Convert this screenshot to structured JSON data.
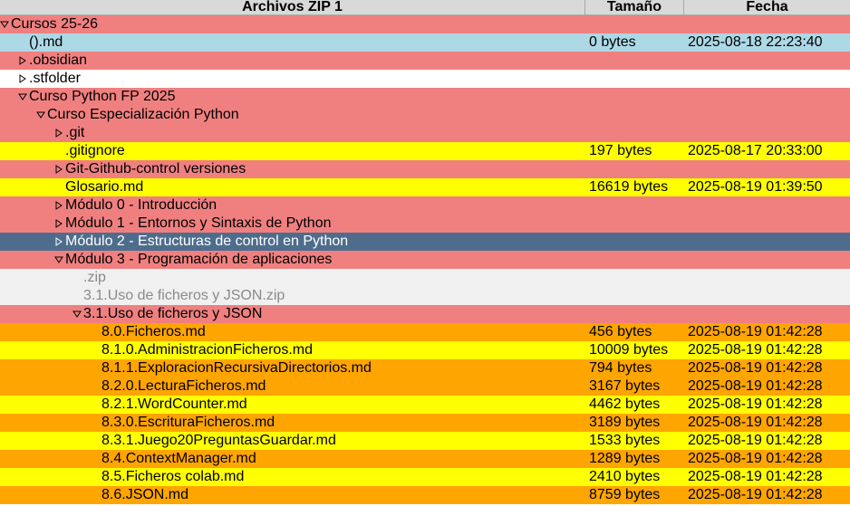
{
  "header": {
    "name": "Archivos ZIP 1",
    "size": "Tamaño",
    "date": "Fecha"
  },
  "colors": {
    "folder": "#f08080",
    "file_blue": "#add8e6",
    "plain": "#ffffff",
    "file_yellow": "#ffff00",
    "file_orange": "#ffa500",
    "zip_grey": "#f0f0f0",
    "selected": "#4e6d8c"
  },
  "rows": [
    {
      "name": "Cursos  25-26",
      "depth": 0,
      "toggle": "expanded",
      "bg": "red",
      "size": "",
      "date": ""
    },
    {
      "name": "().md",
      "depth": 1,
      "toggle": "none",
      "bg": "blue",
      "size": "0 bytes",
      "date": "2025-08-18 22:23:40"
    },
    {
      "name": ".obsidian",
      "depth": 1,
      "toggle": "collapsed",
      "bg": "red",
      "size": "",
      "date": ""
    },
    {
      "name": ".stfolder",
      "depth": 1,
      "toggle": "collapsed",
      "bg": "white",
      "size": "",
      "date": ""
    },
    {
      "name": "Curso Python FP 2025",
      "depth": 1,
      "toggle": "expanded",
      "bg": "red",
      "size": "",
      "date": ""
    },
    {
      "name": "Curso Especialización Python",
      "depth": 2,
      "toggle": "expanded",
      "bg": "red",
      "size": "",
      "date": ""
    },
    {
      "name": ".git",
      "depth": 3,
      "toggle": "collapsed",
      "bg": "red",
      "size": "",
      "date": ""
    },
    {
      "name": ".gitignore",
      "depth": 3,
      "toggle": "none",
      "bg": "yellow",
      "size": "197 bytes",
      "date": "2025-08-17 20:33:00"
    },
    {
      "name": "Git-Github-control versiones",
      "depth": 3,
      "toggle": "collapsed",
      "bg": "red",
      "size": "",
      "date": ""
    },
    {
      "name": "Glosario.md",
      "depth": 3,
      "toggle": "none",
      "bg": "yellow",
      "size": "16619 bytes",
      "date": "2025-08-19 01:39:50"
    },
    {
      "name": "Módulo 0 - Introducción",
      "depth": 3,
      "toggle": "collapsed",
      "bg": "red",
      "size": "",
      "date": ""
    },
    {
      "name": "Módulo 1 - Entornos y Sintaxis de Python",
      "depth": 3,
      "toggle": "collapsed",
      "bg": "red",
      "size": "",
      "date": ""
    },
    {
      "name": "Módulo 2 - Estructuras de control en Python",
      "depth": 3,
      "toggle": "collapsed",
      "bg": "selected",
      "size": "",
      "date": ""
    },
    {
      "name": "Módulo 3 - Programación de aplicaciones",
      "depth": 3,
      "toggle": "expanded",
      "bg": "red",
      "size": "",
      "date": ""
    },
    {
      "name": ".zip",
      "depth": 4,
      "toggle": "none",
      "bg": "grey",
      "size": "",
      "date": ""
    },
    {
      "name": "3.1.Uso de ficheros y JSON.zip",
      "depth": 4,
      "toggle": "none",
      "bg": "grey",
      "size": "",
      "date": ""
    },
    {
      "name": "3.1.Uso de ficheros y JSON",
      "depth": 4,
      "toggle": "expanded",
      "bg": "red",
      "size": "",
      "date": ""
    },
    {
      "name": "8.0.Ficheros.md",
      "depth": 5,
      "toggle": "none",
      "bg": "orange",
      "size": "456 bytes",
      "date": "2025-08-19 01:42:28"
    },
    {
      "name": "8.1.0.AdministracionFicheros.md",
      "depth": 5,
      "toggle": "none",
      "bg": "yellow",
      "size": "10009 bytes",
      "date": "2025-08-19 01:42:28"
    },
    {
      "name": "8.1.1.ExploracionRecursivaDirectorios.md",
      "depth": 5,
      "toggle": "none",
      "bg": "orange",
      "size": "794 bytes",
      "date": "2025-08-19 01:42:28"
    },
    {
      "name": "8.2.0.LecturaFicheros.md",
      "depth": 5,
      "toggle": "none",
      "bg": "orange",
      "size": "3167 bytes",
      "date": "2025-08-19 01:42:28"
    },
    {
      "name": "8.2.1.WordCounter.md",
      "depth": 5,
      "toggle": "none",
      "bg": "yellow",
      "size": "4462 bytes",
      "date": "2025-08-19 01:42:28"
    },
    {
      "name": "8.3.0.EscrituraFicheros.md",
      "depth": 5,
      "toggle": "none",
      "bg": "orange",
      "size": "3189 bytes",
      "date": "2025-08-19 01:42:28"
    },
    {
      "name": "8.3.1.Juego20PreguntasGuardar.md",
      "depth": 5,
      "toggle": "none",
      "bg": "yellow",
      "size": "1533 bytes",
      "date": "2025-08-19 01:42:28"
    },
    {
      "name": "8.4.ContextManager.md",
      "depth": 5,
      "toggle": "none",
      "bg": "orange",
      "size": "1289 bytes",
      "date": "2025-08-19 01:42:28"
    },
    {
      "name": "8.5.Ficheros  colab.md",
      "depth": 5,
      "toggle": "none",
      "bg": "yellow",
      "size": "2410 bytes",
      "date": "2025-08-19 01:42:28"
    },
    {
      "name": "8.6.JSON.md",
      "depth": 5,
      "toggle": "none",
      "bg": "orange",
      "size": "8759 bytes",
      "date": "2025-08-19 01:42:28"
    }
  ]
}
